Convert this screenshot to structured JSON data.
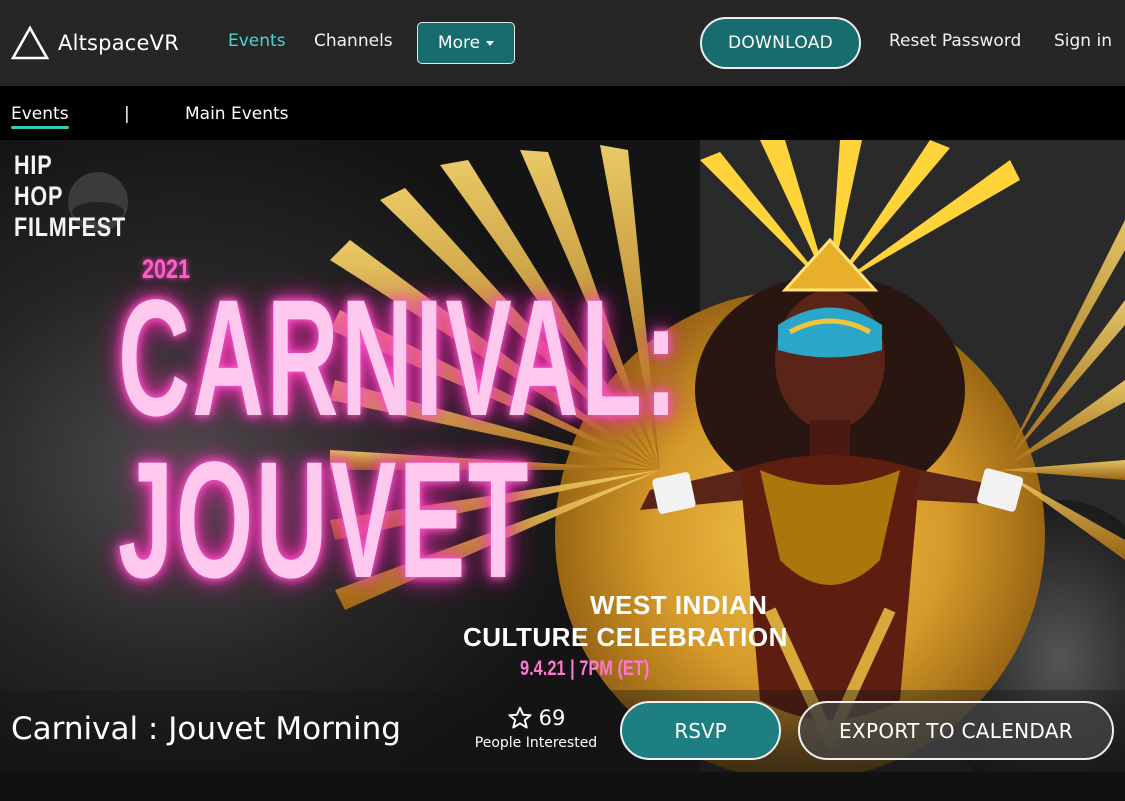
{
  "brand": {
    "name": "AltspaceVR",
    "logo_icon": "triangle-logo-icon"
  },
  "nav": {
    "links": [
      {
        "label": "Events",
        "active": true
      },
      {
        "label": "Channels",
        "active": false
      }
    ],
    "more_label": "More",
    "download_label": "DOWNLOAD",
    "reset_password_label": "Reset Password",
    "sign_in_label": "Sign in"
  },
  "subnav": {
    "events_label": "Events",
    "separator": "|",
    "main_events_label": "Main Events"
  },
  "hero": {
    "festival_lines": [
      "HIP",
      "HOP",
      "FILMFEST"
    ],
    "festival_year": "2021",
    "headline_line1": "CARNIVAL:",
    "headline_line2": "JOUVET",
    "subtitle_line1": "WEST INDIAN",
    "subtitle_line2": "CULTURE CELEBRATION",
    "date_time": "9.4.21 | 7PM (ET)"
  },
  "event": {
    "title": "Carnival : Jouvet Morning",
    "interested_count": "69",
    "interested_label": "People Interested",
    "star_icon": "star-outline-icon",
    "rsvp_label": "RSVP",
    "export_label": "EXPORT TO CALENDAR"
  },
  "colors": {
    "accent": "#176d6e",
    "active_link": "#4fd4d0",
    "neon_pink": "#ff5fc9",
    "gold": "#d4a017"
  }
}
